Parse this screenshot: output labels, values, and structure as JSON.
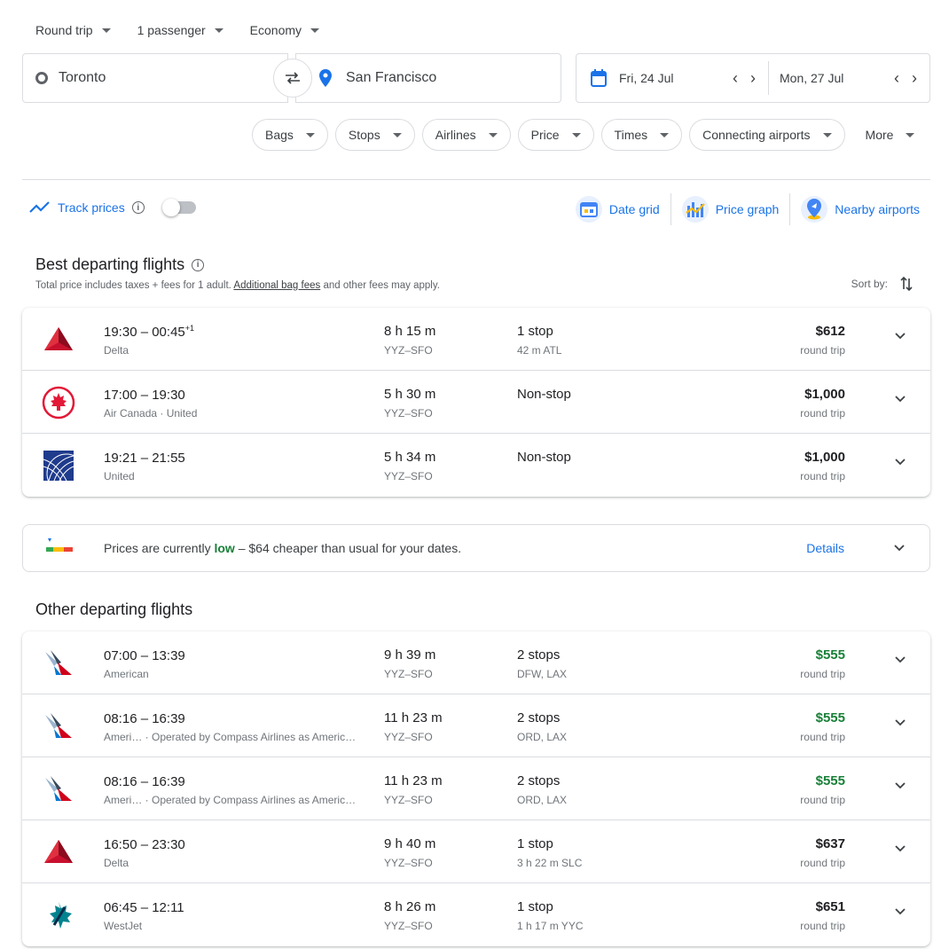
{
  "search": {
    "trip_type": "Round trip",
    "passengers": "1 passenger",
    "cabin": "Economy",
    "from": "Toronto",
    "to": "San Francisco",
    "depart_date": "Fri, 24 Jul",
    "return_date": "Mon, 27 Jul"
  },
  "filters": [
    "Bags",
    "Stops",
    "Airlines",
    "Price",
    "Times",
    "Connecting airports",
    "More"
  ],
  "tools": {
    "track_prices": "Track prices",
    "date_grid": "Date grid",
    "price_graph": "Price graph",
    "nearby_airports": "Nearby airports"
  },
  "best": {
    "title": "Best departing flights",
    "note_before": "Total price includes taxes + fees for 1 adult. ",
    "note_link": "Additional bag fees",
    "note_after": " and other fees may apply.",
    "sort_by": "Sort by:",
    "flights": [
      {
        "logo": "delta-logo",
        "times": "19:30 – 00:45",
        "offset": "+1",
        "airline": "Delta",
        "duration": "8 h 15 m",
        "route": "YYZ–SFO",
        "stops": "1 stop",
        "stop_detail": "42 m ATL",
        "price": "$612",
        "price_type": "round trip",
        "cheap": false
      },
      {
        "logo": "air-canada-logo",
        "times": "17:00 – 19:30",
        "offset": "",
        "airline": "Air Canada · United",
        "duration": "5 h 30 m",
        "route": "YYZ–SFO",
        "stops": "Non-stop",
        "stop_detail": "",
        "price": "$1,000",
        "price_type": "round trip",
        "cheap": false
      },
      {
        "logo": "united-logo",
        "times": "19:21 – 21:55",
        "offset": "",
        "airline": "United",
        "duration": "5 h 34 m",
        "route": "YYZ–SFO",
        "stops": "Non-stop",
        "stop_detail": "",
        "price": "$1,000",
        "price_type": "round trip",
        "cheap": false
      }
    ]
  },
  "insight": {
    "prefix": "Prices are currently ",
    "level": "low",
    "suffix": " – $64 cheaper than usual for your dates.",
    "details": "Details"
  },
  "other": {
    "title": "Other departing flights",
    "flights": [
      {
        "logo": "american-logo",
        "times": "07:00 – 13:39",
        "offset": "",
        "airline": "American",
        "duration": "9 h 39 m",
        "route": "YYZ–SFO",
        "stops": "2 stops",
        "stop_detail": "DFW, LAX",
        "price": "$555",
        "price_type": "round trip",
        "cheap": true
      },
      {
        "logo": "american-logo",
        "times": "08:16 – 16:39",
        "offset": "",
        "airline": "Ameri…   · Operated by Compass Airlines as Americ…",
        "duration": "11 h 23 m",
        "route": "YYZ–SFO",
        "stops": "2 stops",
        "stop_detail": "ORD, LAX",
        "price": "$555",
        "price_type": "round trip",
        "cheap": true
      },
      {
        "logo": "american-logo",
        "times": "08:16 – 16:39",
        "offset": "",
        "airline": "Ameri…   · Operated by Compass Airlines as Americ…",
        "duration": "11 h 23 m",
        "route": "YYZ–SFO",
        "stops": "2 stops",
        "stop_detail": "ORD, LAX",
        "price": "$555",
        "price_type": "round trip",
        "cheap": true
      },
      {
        "logo": "delta-logo",
        "times": "16:50 – 23:30",
        "offset": "",
        "airline": "Delta",
        "duration": "9 h 40 m",
        "route": "YYZ–SFO",
        "stops": "1 stop",
        "stop_detail": "3 h 22 m SLC",
        "price": "$637",
        "price_type": "round trip",
        "cheap": false
      },
      {
        "logo": "westjet-logo",
        "times": "06:45 – 12:11",
        "offset": "",
        "airline": "WestJet",
        "duration": "8 h 26 m",
        "route": "YYZ–SFO",
        "stops": "1 stop",
        "stop_detail": "1 h 17 m YYC",
        "price": "$651",
        "price_type": "round trip",
        "cheap": false
      }
    ]
  },
  "colors": {
    "accent": "#1a73e8",
    "cheap": "#188038",
    "delta": "#c8102e",
    "air_canada": "#e31837",
    "united": "#1f3b8c",
    "westjet": "#00838f"
  }
}
